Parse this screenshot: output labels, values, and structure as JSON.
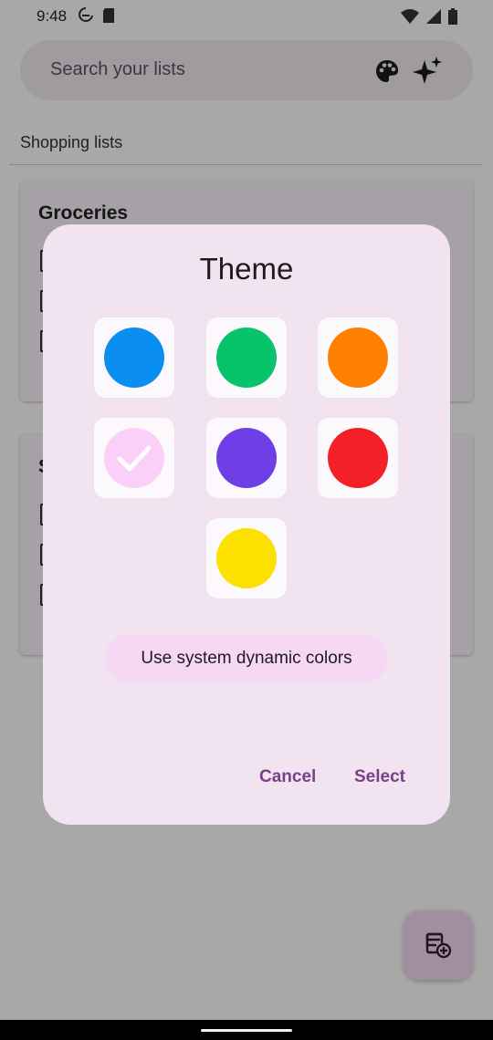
{
  "status_bar": {
    "time": "9:48"
  },
  "search": {
    "placeholder": "Search your lists"
  },
  "section": {
    "title": "Shopping lists"
  },
  "cards": [
    {
      "title": "Groceries"
    },
    {
      "title": "S"
    }
  ],
  "dialog": {
    "title": "Theme",
    "swatches": [
      {
        "name": "blue",
        "color": "#0a8ef0",
        "selected": false
      },
      {
        "name": "green",
        "color": "#07c46b",
        "selected": false
      },
      {
        "name": "orange",
        "color": "#ff8000",
        "selected": false
      },
      {
        "name": "pink",
        "color": "#fbd0f8",
        "selected": true
      },
      {
        "name": "purple",
        "color": "#6e3fe6",
        "selected": false
      },
      {
        "name": "red",
        "color": "#f42027",
        "selected": false
      },
      {
        "name": "yellow",
        "color": "#fbe000",
        "selected": false
      }
    ],
    "dynamic_colors_label": "Use system dynamic colors",
    "cancel_label": "Cancel",
    "select_label": "Select"
  },
  "colors": {
    "accent": "#7a3f8a",
    "dialog_bg": "#f1e4f0"
  }
}
